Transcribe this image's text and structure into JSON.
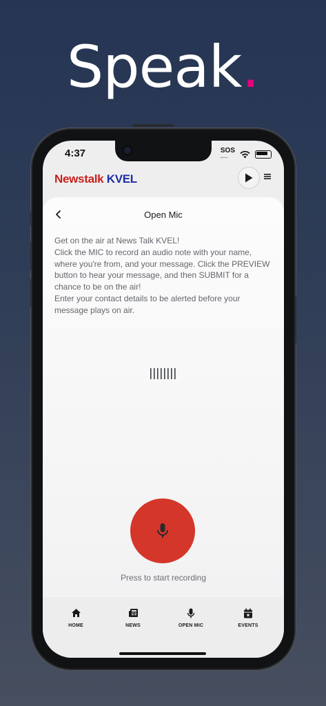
{
  "promo": {
    "headline": "Speak",
    "dot": "."
  },
  "status_bar": {
    "time": "4:37",
    "sos": "SOS"
  },
  "header": {
    "brand_part1": "Newstalk",
    "brand_part2": "KVEL"
  },
  "page": {
    "title": "Open Mic",
    "description": [
      "Get on the air at News Talk KVEL!",
      "Click the MIC to record an audio note with your name, where you're from, and your message.  Click the PREVIEW button to hear your message, and then SUBMIT for a chance to be on the air!",
      "Enter your contact details to be alerted before your message plays on air."
    ],
    "waveform": "||||||||",
    "record_hint": "Press to start recording"
  },
  "tabs": [
    {
      "label": "HOME",
      "icon": "home-icon"
    },
    {
      "label": "NEWS",
      "icon": "newspaper-icon"
    },
    {
      "label": "OPEN MIC",
      "icon": "microphone-icon"
    },
    {
      "label": "EVENTS",
      "icon": "calendar-icon"
    }
  ],
  "colors": {
    "accent_dot": "#e6007e",
    "record_button": "#d5362a",
    "brand_red": "#c8201d",
    "brand_blue": "#1d2ea8"
  }
}
